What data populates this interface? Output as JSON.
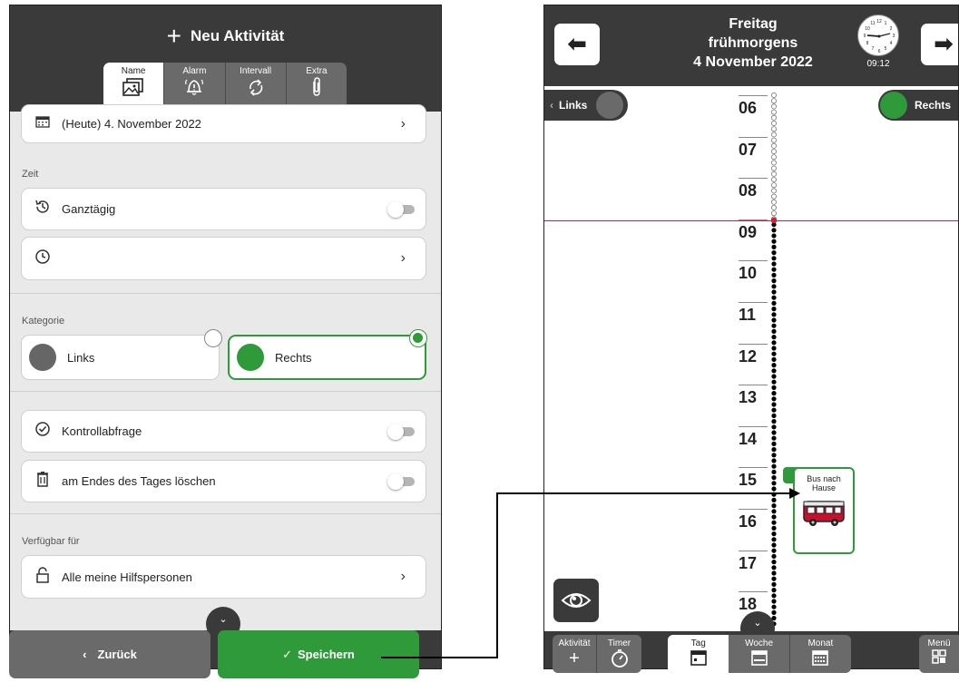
{
  "left": {
    "header": {
      "title": "Neu Aktivität",
      "plus": "+"
    },
    "tabs": [
      {
        "label": "Name",
        "icon": "image-icon",
        "glyph": "🖼"
      },
      {
        "label": "Alarm",
        "icon": "alarm-bell-icon",
        "glyph": "🔔"
      },
      {
        "label": "Intervall",
        "icon": "repeat-icon",
        "glyph": "⟳"
      },
      {
        "label": "Extra",
        "icon": "paperclip-icon",
        "glyph": "📎"
      }
    ],
    "date": {
      "value": "(Heute) 4. November 2022",
      "chev": "›"
    },
    "section_zeit": "Zeit",
    "all_day": {
      "label": "Ganztägig",
      "on": false
    },
    "time": {
      "value": "",
      "chev": "›"
    },
    "section_kategorie": "Kategorie",
    "category_left": {
      "label": "Links",
      "color": "#666666",
      "selected": false
    },
    "category_right": {
      "label": "Rechts",
      "color": "#2e9a3a",
      "selected": true
    },
    "check": {
      "label": "Kontrollabfrage",
      "on": false
    },
    "delete": {
      "label": "am Endes des Tages löschen",
      "on": false
    },
    "section_available": "Verfügbar für",
    "available": {
      "label": "Alle meine Hilfspersonen",
      "chev": "›"
    },
    "scroll": "⌄",
    "back_button": {
      "label": "Zurück",
      "glyph": "‹"
    },
    "save_button": {
      "label": "Speichern",
      "glyph": "✓"
    }
  },
  "right": {
    "header": {
      "day": "Freitag",
      "period": "frühmorgens",
      "date": "4 November 2022"
    },
    "clock_time": "09:12",
    "prev_glyph": "⬅",
    "next_glyph": "➡",
    "left_pill": {
      "label": "Links",
      "glyph": "‹"
    },
    "right_pill": {
      "label": "Rechts"
    },
    "hours": [
      "06",
      "07",
      "08",
      "09",
      "10",
      "11",
      "12",
      "13",
      "14",
      "15",
      "16",
      "17",
      "18"
    ],
    "event": {
      "title_line1": "Bus nach",
      "title_line2": "Hause",
      "icon": "bus-icon"
    },
    "footer": {
      "activity": "Aktivität",
      "activity_glyph": "+",
      "timer": "Timer",
      "timer_glyph": "⏱",
      "day": "Tag",
      "week": "Woche",
      "month": "Monat",
      "menu": "Menü"
    },
    "colors": {
      "accent": "#2e9a3a",
      "dark": "#3a3a3a",
      "now_line": "#d0213a"
    }
  }
}
